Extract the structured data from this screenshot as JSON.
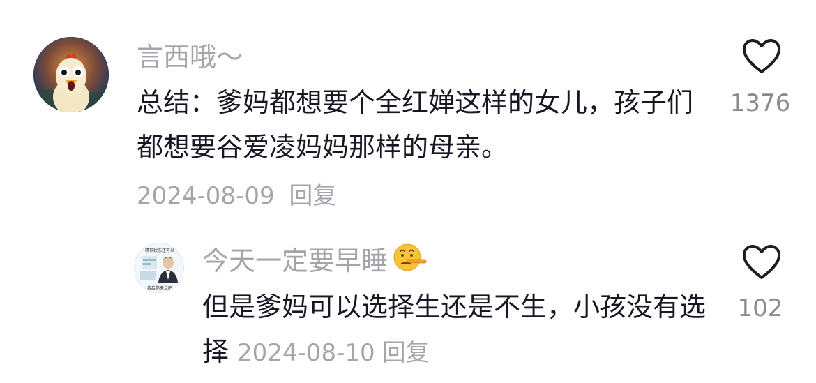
{
  "comments": [
    {
      "username": "言西哦～",
      "text": "总结：爹妈都想要个全红婵这样的女儿，孩子们都想要谷爱凌妈妈那样的母亲。",
      "date": "2024-08-09",
      "reply_label": "回复",
      "likes": "1376",
      "avatar_icon": "screaming-chicken-avatar"
    },
    {
      "username": "今天一定要早睡",
      "username_emoji": "lying-face-emoji",
      "text": "但是爹妈可以选择生还是不生，小孩没有选择",
      "date": "2024-08-10",
      "reply_label": "回复",
      "likes": "102",
      "avatar_icon": "person-photo-avatar",
      "avatar_caption_top": "精神状态还可以",
      "avatar_caption_bottom": "我给你来点吧"
    }
  ],
  "colors": {
    "primary_text": "#161823",
    "secondary_text": "#a3a5aa",
    "like_count": "#8a8b91",
    "background": "#ffffff"
  }
}
